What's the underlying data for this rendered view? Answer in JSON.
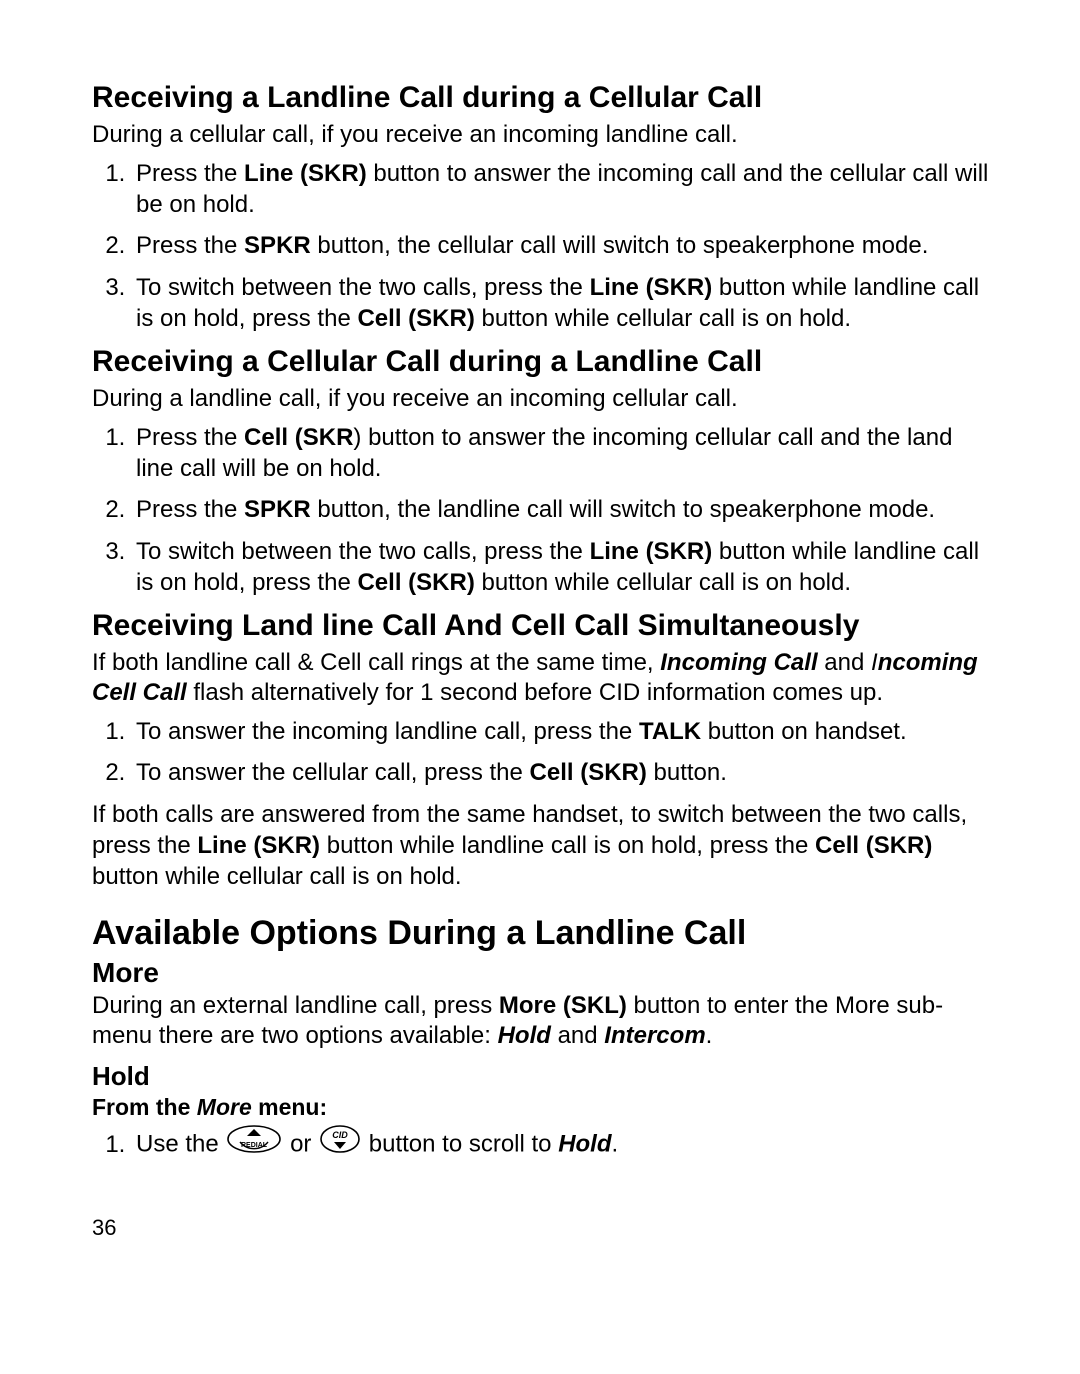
{
  "sec1": {
    "heading": "Receiving a Landline Call during a Cellular Call",
    "intro": "During a cellular call, if you receive an incoming landline call.",
    "s1a": "Press the ",
    "s1b": "Line (SKR)",
    "s1c": " button to answer the incoming call and the cellular call will be on hold.",
    "s2a": "Press the ",
    "s2b": "SPKR",
    "s2c": " button, the cellular call will switch to speakerphone mode.",
    "s3a": "To switch between the two calls, press the ",
    "s3b": "Line (SKR)",
    "s3c": " button while landline call is on hold, press the ",
    "s3d": "Cell (SKR)",
    "s3e": " button while cellular call is on hold."
  },
  "sec2": {
    "heading": "Receiving a Cellular Call during a Landline Call",
    "intro": "During a landline call, if you receive an incoming cellular call.",
    "s1a": "Press the ",
    "s1b": "Cell (SKR",
    "s1c": ") button to answer the incoming cellular call and the land line call will be on hold.",
    "s2a": "Press the ",
    "s2b": "SPKR",
    "s2c": " button, the landline call will switch to speakerphone mode.",
    "s3a": "To switch between the two calls, press the ",
    "s3b": "Line (SKR)",
    "s3c": " button while landline call is on hold, press the ",
    "s3d": "Cell (SKR)",
    "s3e": " button while cellular call is on hold."
  },
  "sec3": {
    "heading": "Receiving Land line Call And Cell Call Simultaneously",
    "p1a": "If both landline call & Cell call rings at the same time, ",
    "p1b": "Incoming Call",
    "p1c": " and ",
    "p1d_i": "I",
    "p1d_rest": "ncoming Cell Call",
    "p1e": " flash alternatively for 1 second before CID information comes up.",
    "s1a": "To answer the incoming landline call, press the ",
    "s1b": "TALK",
    "s1c": " button on handset.",
    "s2a": "To answer the cellular call, press the ",
    "s2b": "Cell (SKR)",
    "s2c": " button.",
    "p2a": "If both calls are answered from the same handset, to switch between the two calls, press the ",
    "p2b": "Line (SKR)",
    "p2c": " button while landline call is on hold, press the ",
    "p2d": "Cell (SKR)",
    "p2e": " button while cellular call is on hold."
  },
  "sec4": {
    "heading": "Available Options During a Landline Call",
    "more": "More",
    "p1a": "During an external landline call, press ",
    "p1b": "More (SKL)",
    "p1c": " button to enter the More sub-menu there are two options available: ",
    "p1d": "Hold",
    "p1e": " and ",
    "p1f": "Intercom",
    "p1g": ".",
    "hold": "Hold",
    "from_a": "From the ",
    "from_b": "More",
    "from_c": " menu:",
    "s1a": "Use the ",
    "s1b": " or ",
    "s1c": " button to scroll to ",
    "s1d": "Hold",
    "s1e": "."
  },
  "page_number": "36"
}
